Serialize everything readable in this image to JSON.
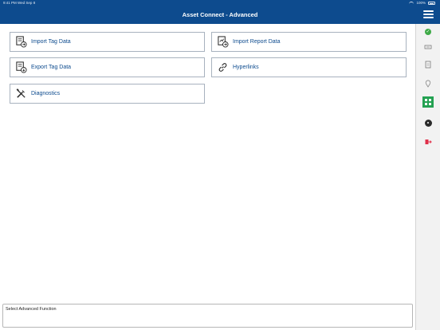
{
  "status_bar": {
    "left_text": "9:41 PM  Wed Sep 8",
    "battery_percent": "100%"
  },
  "nav": {
    "title": "Asset Connect - Advanced",
    "menu_icon": "hamburger-menu-icon"
  },
  "functions": [
    {
      "label": "Import Tag Data",
      "icon": "import-tag-icon"
    },
    {
      "label": "Import Report Data",
      "icon": "import-report-icon"
    },
    {
      "label": "Export Tag Data",
      "icon": "export-tag-icon"
    },
    {
      "label": "Hyperlinks",
      "icon": "link-icon"
    },
    {
      "label": "Diagnostics",
      "icon": "tools-icon"
    }
  ],
  "right_rail": [
    {
      "icon": "check-circle-icon",
      "color": "#3eaa47"
    },
    {
      "icon": "tag-icon"
    },
    {
      "icon": "document-icon"
    },
    {
      "icon": "location-pin-icon"
    },
    {
      "icon": "grid-icon",
      "color": "#24a152",
      "selected": true
    },
    {
      "icon": "gear-icon"
    },
    {
      "icon": "exit-icon",
      "color": "#e0304a"
    }
  ],
  "status_box": {
    "text": "Select Advanced Function"
  },
  "colors": {
    "header": "#0d4b8e",
    "button_text": "#0d4b8e",
    "button_border": "#a8b2be"
  }
}
